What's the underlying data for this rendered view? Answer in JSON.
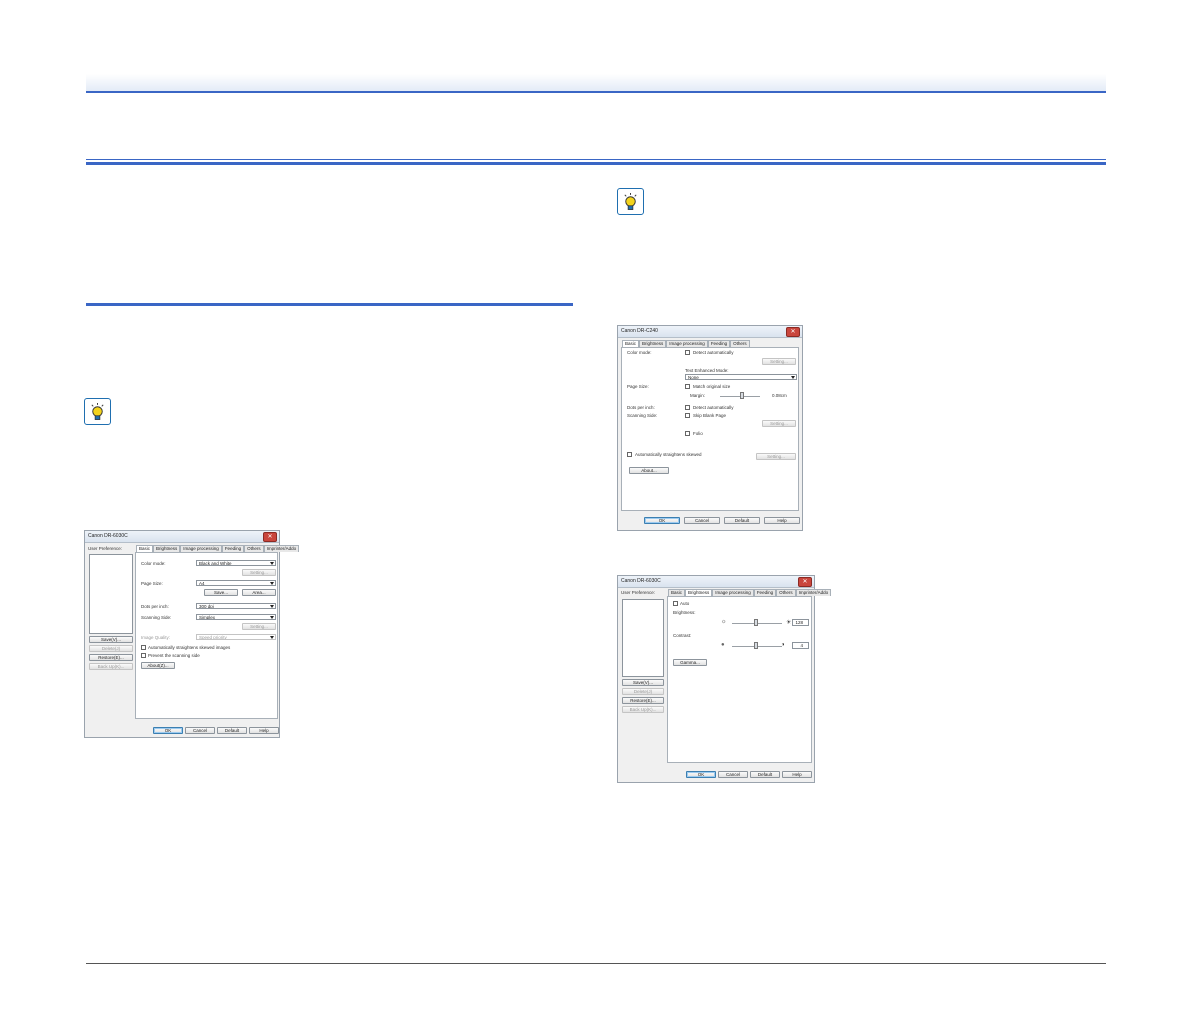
{
  "dialog_a": {
    "title": "Canon DR-6030C",
    "user_pref_label": "User Preference:",
    "tabs": [
      "Basic",
      "Brightness",
      "Image processing",
      "Feeding",
      "Others",
      "Imprinter/Addo"
    ],
    "color_mode_label": "Color mode:",
    "color_mode_value": "Black and White",
    "setting_label": "Setting...",
    "page_size_label": "Page Size:",
    "page_size_value": "A4",
    "save_label": "Save...",
    "area_label": "Area...",
    "dpi_label": "Dots per inch:",
    "dpi_value": "300 dpi",
    "scanning_side_label": "Scanning Side:",
    "scanning_side_value": "Simplex",
    "image_quality_label": "Image Quality:",
    "image_quality_value": "Speed priority",
    "auto_straighten_label": "Automatically straightens skewed images",
    "prevent_bleed_label": "Prevent the scanning side",
    "about_label": "About(Z)...",
    "side_buttons": [
      "Save(V)...",
      "Delete(J)",
      "Restore(E)...",
      "Back Up(K)..."
    ],
    "ok_label": "OK",
    "cancel_label": "Cancel",
    "default_label": "Default",
    "help_label": "Help"
  },
  "dialog_b": {
    "title": "Canon DR-C240",
    "tabs": [
      "Basic",
      "Brightness",
      "Image processing",
      "Feeding",
      "Others"
    ],
    "color_mode_label": "Color mode:",
    "detect_auto_label": "Detect automatically",
    "setting_label": "Setting...",
    "text_enhanced_label": "Text Enhanced Mode:",
    "text_enhanced_value": "None",
    "page_size_label": "Page Size:",
    "match_size_label": "Match original size",
    "margin_label": "Margin:",
    "margin_value": "0.08cm",
    "dpi_label": "Dots per inch:",
    "dpi_detect_label": "Detect automatically",
    "scanning_side_label": "Scanning Side:",
    "skip_blank_label": "Skip Blank Page",
    "folio_label": "Folio",
    "auto_straighten_label": "Automatically straightens skewed",
    "about_label": "About...",
    "ok_label": "OK",
    "cancel_label": "Cancel",
    "default_label": "Default",
    "help_label": "Help"
  },
  "dialog_c": {
    "title": "Canon DR-6030C",
    "user_pref_label": "User Preference:",
    "tabs": [
      "Basic",
      "Brightness",
      "Image processing",
      "Feeding",
      "Others",
      "Imprinter/Addo"
    ],
    "auto_label": "Auto",
    "brightness_label": "Brightness:",
    "brightness_value": "128",
    "contrast_label": "Contrast:",
    "contrast_value": "4",
    "gamma_label": "Gamma...",
    "side_buttons": [
      "Save(V)...",
      "Delete(J)",
      "Restore(E)...",
      "Back Up(K)..."
    ],
    "ok_label": "OK",
    "cancel_label": "Cancel",
    "default_label": "Default",
    "help_label": "Help"
  },
  "icons": [
    "hint-icon",
    "hint-icon",
    "close-icon"
  ],
  "colors": {
    "accent": "#3a66c5",
    "hint_blue": "#1f6fb0",
    "bulb_yellow": "#f3d31c"
  }
}
